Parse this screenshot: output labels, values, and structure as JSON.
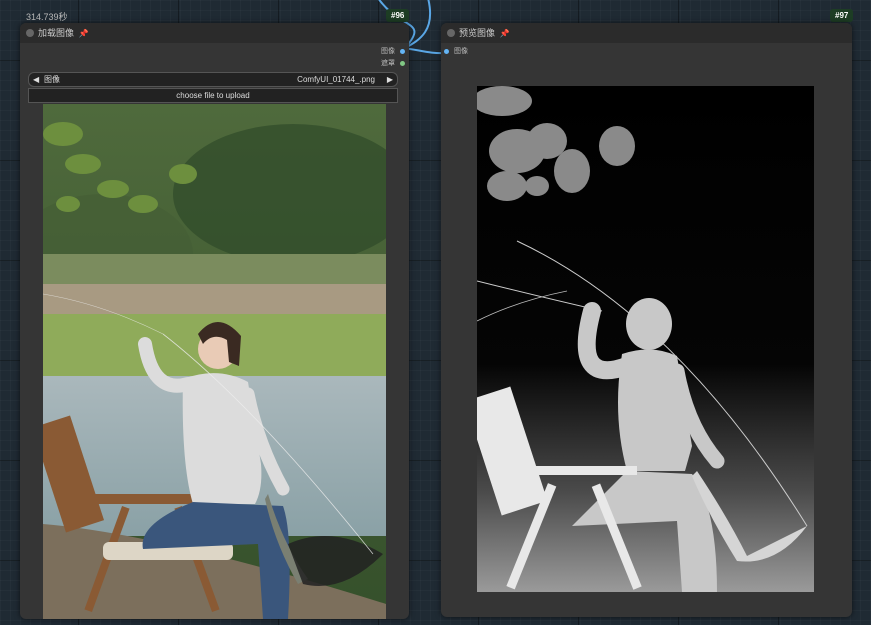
{
  "exec_time": "314.739秒",
  "nodes": {
    "load": {
      "id_badge": "#96",
      "title": "加载图像",
      "outputs": [
        {
          "label": "图像",
          "color": "#64b5f6"
        },
        {
          "label": "遮罩",
          "color": "#81c784"
        }
      ],
      "image_widget": {
        "label": "图像",
        "value": "ComfyUI_01744_.png"
      },
      "upload_label": "choose file to upload"
    },
    "preview": {
      "id_badge": "#97",
      "title": "预览图像",
      "inputs": [
        {
          "label": "图像",
          "color": "#64b5f6"
        }
      ]
    }
  },
  "icons": {
    "pin": "pin-icon",
    "arrow_left": "◀",
    "arrow_right": "▶"
  },
  "colors": {
    "link": "#5aa7e6",
    "node_bg": "#353535",
    "title_bg": "#2b2b2b",
    "badge_bg": "#1d3d24"
  }
}
